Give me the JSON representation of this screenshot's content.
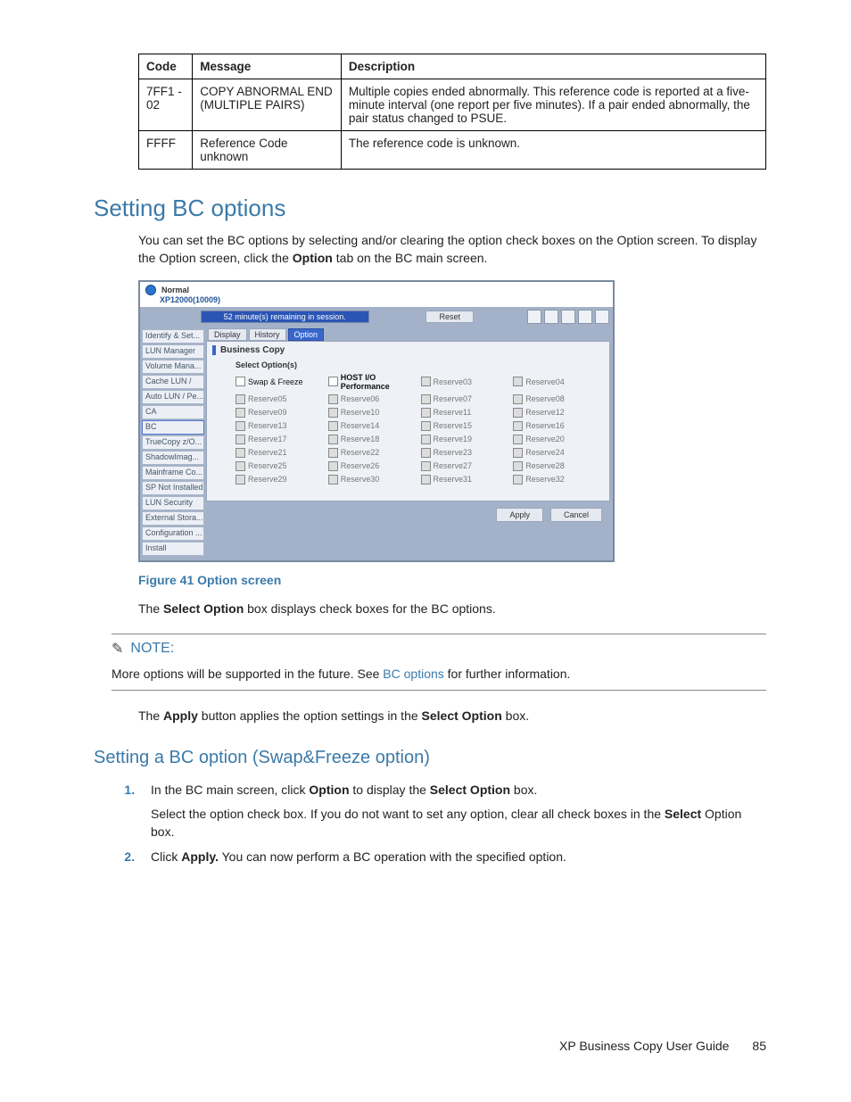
{
  "table": {
    "headers": [
      "Code",
      "Message",
      "Description"
    ],
    "rows": [
      {
        "code": "7FF1 - 02",
        "message": "COPY ABNORMAL END (MULTIPLE PAIRS)",
        "description": "Multiple copies ended abnormally. This reference code is reported at a five-minute interval (one report per five minutes). If a pair ended abnormally, the pair status changed to PSUE."
      },
      {
        "code": "FFFF",
        "message": "Reference Code unknown",
        "description": "The reference code is unknown."
      }
    ]
  },
  "section1": {
    "title": "Setting BC options",
    "p1a": "You can set the BC options by selecting and/or clearing the option check boxes on the Option screen. To display the Option screen, click the ",
    "p1b": "Option",
    "p1c": " tab on the BC main screen."
  },
  "figure": {
    "caption": "Figure 41 Option screen",
    "status": "Normal",
    "device": "XP12000(10009)",
    "remaining": "52 minute(s) remaining in session.",
    "reset": "Reset",
    "tabs": [
      "Display",
      "History",
      "Option"
    ],
    "panel_title": "Business Copy",
    "select_title": "Select Option(s)",
    "row0": [
      "Swap & Freeze",
      "HOST I/O Performance",
      "Reserve03",
      "Reserve04"
    ],
    "reserves": [
      "Reserve05",
      "Reserve06",
      "Reserve07",
      "Reserve08",
      "Reserve09",
      "Reserve10",
      "Reserve11",
      "Reserve12",
      "Reserve13",
      "Reserve14",
      "Reserve15",
      "Reserve16",
      "Reserve17",
      "Reserve18",
      "Reserve19",
      "Reserve20",
      "Reserve21",
      "Reserve22",
      "Reserve23",
      "Reserve24",
      "Reserve25",
      "Reserve26",
      "Reserve27",
      "Reserve28",
      "Reserve29",
      "Reserve30",
      "Reserve31",
      "Reserve32"
    ],
    "apply": "Apply",
    "cancel": "Cancel",
    "sidebar": [
      "Identify & Set...",
      "LUN Manager",
      "Volume Mana...",
      "Cache LUN /",
      "Auto LUN / Pe...",
      "CA",
      "BC",
      "TrueCopy z/O...",
      "ShadowImag...",
      "Mainframe Co...",
      "SP Not Installed",
      "LUN Security",
      "External Stora...",
      "Configuration ...",
      "Install"
    ]
  },
  "after_figure": {
    "p1a": "The ",
    "p1b": "Select Option",
    "p1c": " box displays check boxes for the BC options."
  },
  "note": {
    "heading": "NOTE:",
    "text_a": "More options will be supported in the future. See ",
    "link": "BC options",
    "text_b": " for further information."
  },
  "apply_line": {
    "a": "The ",
    "b": "Apply",
    "c": " button applies the option settings in the ",
    "d": "Select Option",
    "e": " box."
  },
  "section2": {
    "title": "Setting a BC option (Swap&Freeze option)",
    "step1": {
      "a": "In the BC main screen, click ",
      "b": "Option",
      "c": " to display the ",
      "d": "Select Option",
      "e": " box.",
      "p2a": "Select the option check box. If you do not want to set any option, clear all check boxes in the ",
      "p2b": "Select",
      "p2c": " Option box."
    },
    "step2": {
      "a": "Click ",
      "b": "Apply.",
      "c": " You can now perform a BC operation with the specified option."
    }
  },
  "footer": {
    "title": "XP Business Copy User Guide",
    "page": "85"
  }
}
